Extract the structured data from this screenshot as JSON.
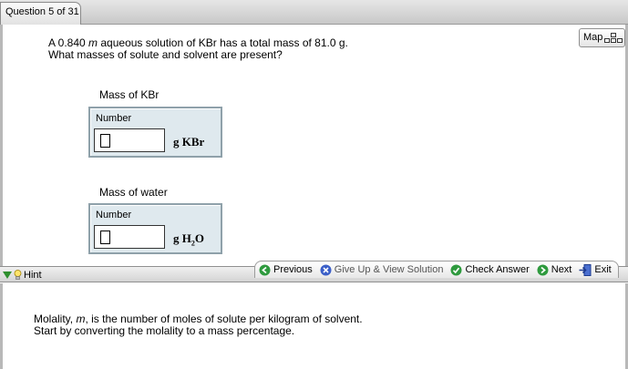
{
  "header": {
    "question_counter": "Question 5 of 31"
  },
  "map_button": {
    "label": "Map",
    "icon": "sitemap-icon"
  },
  "question": {
    "line1_pre": "A 0.840 ",
    "line1_unit": "m",
    "line1_post": " aqueous solution of KBr has a total mass of 81.0 g.",
    "line2": "What masses of solute and solvent are present?"
  },
  "fields": [
    {
      "label": "Mass of KBr",
      "box_caption": "Number",
      "value": "",
      "unit_main": "g  KBr",
      "unit_sub": "",
      "unit_tail": ""
    },
    {
      "label": "Mass of water",
      "box_caption": "Number",
      "value": "",
      "unit_main": "g  H",
      "unit_sub": "2",
      "unit_tail": "O"
    }
  ],
  "nav": {
    "previous": "Previous",
    "give_up": "Give Up & View Solution",
    "check": "Check Answer",
    "next": "Next",
    "exit": "Exit"
  },
  "hint": {
    "tab_label": "Hint",
    "line1_pre": "Molality, ",
    "line1_var": "m",
    "line1_post": ", is the number of moles of solute per kilogram of solvent.",
    "line2": "Start by converting the molality to a mass percentage."
  },
  "colors": {
    "box_bg": "#dfe9ee",
    "box_border": "#8fa1aa",
    "nav_green": "#2e9a3e",
    "nav_blue": "#3b5fc8"
  }
}
